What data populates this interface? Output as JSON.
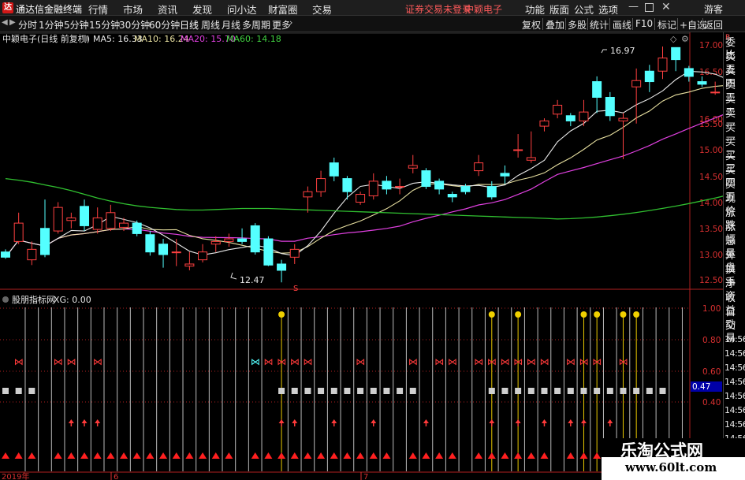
{
  "app": {
    "title": "通达信金融终端",
    "menu": [
      "行情",
      "市场",
      "资讯",
      "发现",
      "问小达",
      "财富圈",
      "交易"
    ],
    "notice": "证券交易未登录",
    "stock_name": "中颖电子",
    "right_menu": [
      "功能",
      "版面",
      "公式",
      "选项"
    ],
    "guest": "游客"
  },
  "toolbar": {
    "periods": [
      "分时",
      "1分钟",
      "5分钟",
      "15分钟",
      "30分钟",
      "60分钟",
      "日线",
      "周线",
      "月线",
      "多周期",
      "更多"
    ],
    "selected": "日线",
    "right_buttons": [
      "复权",
      "叠加",
      "多股",
      "统计",
      "画线",
      "F10",
      "标记",
      "+自选",
      "返回"
    ]
  },
  "kline": {
    "legend_title": "中颖电子(日线 前复权)",
    "ma": [
      {
        "label": "MA5: 16.33",
        "color": "#e8e8e8"
      },
      {
        "label": "MA10: 16.24",
        "color": "#e8e0a0"
      },
      {
        "label": "MA20: 15.70",
        "color": "#e040e0"
      },
      {
        "label": "MA60: 14.18",
        "color": "#40d040"
      }
    ],
    "price_axis": [
      "17.00",
      "16.50",
      "16.00",
      "15.50",
      "15.00",
      "14.50",
      "14.00",
      "13.50",
      "13.00",
      "12.50"
    ],
    "high_label": "16.97",
    "low_label": "12.47",
    "marker_s": "S",
    "colors": {
      "up": "#ff4040",
      "down": "#54ffff",
      "ma5": "#e8e8e8",
      "ma10": "#e8e0a0",
      "ma20": "#e040e0",
      "ma60": "#30c030"
    }
  },
  "indicator": {
    "name": "股朋指标网",
    "label": "XG: 0.00",
    "axis": [
      "1.00",
      "0.80",
      "0.60",
      "0.40"
    ],
    "current": "0.47"
  },
  "xaxis": {
    "year": "2019年",
    "m6": "6",
    "m7": "7"
  },
  "quote_panel": {
    "labels": [
      "委比",
      "卖五",
      "卖四",
      "卖三",
      "卖二",
      "卖一",
      "买一",
      "买二",
      "买三",
      "买四",
      "买五",
      "现价",
      "涨跌",
      "涨幅",
      "总量",
      "外盘",
      "换手",
      "净资",
      "收益"
    ],
    "bottom": [
      "自动",
      "交易",
      "14:56",
      "14:56",
      "14:56",
      "14:56",
      "14:56",
      "14:56",
      "14:56",
      "14:56"
    ]
  },
  "watermark": {
    "title": "乐淘公式网",
    "url": "www.60lt.com"
  },
  "chart_data": {
    "type": "candlestick",
    "open": [
      13.05,
      13.25,
      12.9,
      13.5,
      13.45,
      13.65,
      13.92,
      13.48,
      13.5,
      13.52,
      13.6,
      13.38,
      13.2,
      13.05,
      12.78,
      12.9,
      13.2,
      13.25,
      13.3,
      13.55,
      13.3,
      12.82,
      12.95,
      14.1,
      14.2,
      14.75,
      14.45,
      14.0,
      14.12,
      14.4,
      14.3,
      14.65,
      14.6,
      14.4,
      14.15,
      14.3,
      14.6,
      14.3,
      14.55,
      15.0,
      14.8,
      15.45,
      15.68,
      15.65,
      15.55,
      16.3,
      16.0,
      15.55,
      16.2,
      16.5,
      16.5,
      16.95,
      16.55,
      16.3,
      16.1,
      16.22,
      16.0
    ],
    "close": [
      12.95,
      13.6,
      13.1,
      13.0,
      13.9,
      13.7,
      13.55,
      13.7,
      13.8,
      13.6,
      13.4,
      13.05,
      13.0,
      13.05,
      12.82,
      13.05,
      13.25,
      13.3,
      13.25,
      13.05,
      12.8,
      12.7,
      13.1,
      14.2,
      14.45,
      14.5,
      14.2,
      14.15,
      14.4,
      14.25,
      14.3,
      14.7,
      14.3,
      14.25,
      14.1,
      14.2,
      14.75,
      14.1,
      14.5,
      15.0,
      14.85,
      15.55,
      15.85,
      15.55,
      15.72,
      16.0,
      15.65,
      15.6,
      16.32,
      16.3,
      16.75,
      16.72,
      16.4,
      16.25,
      16.1,
      16.22,
      16.3
    ],
    "high": [
      13.1,
      13.8,
      13.25,
      14.05,
      14.0,
      13.8,
      14.05,
      13.9,
      13.95,
      13.7,
      13.65,
      13.45,
      13.3,
      13.3,
      13.05,
      13.2,
      13.35,
      13.4,
      13.5,
      13.6,
      13.35,
      12.9,
      13.2,
      14.3,
      14.6,
      14.85,
      14.5,
      14.2,
      14.55,
      14.5,
      14.45,
      14.9,
      14.65,
      14.45,
      14.2,
      14.35,
      14.9,
      14.4,
      14.7,
      15.3,
      15.35,
      15.6,
      15.95,
      15.7,
      15.95,
      16.4,
      16.1,
      15.7,
      16.55,
      16.62,
      16.97,
      16.95,
      16.6,
      16.4,
      16.3,
      16.5,
      16.4
    ],
    "low": [
      12.92,
      13.2,
      12.8,
      12.95,
      13.4,
      13.5,
      13.45,
      13.4,
      13.45,
      13.45,
      13.35,
      12.98,
      12.75,
      12.78,
      12.7,
      12.85,
      13.05,
      13.15,
      13.2,
      13.0,
      12.78,
      12.47,
      12.82,
      13.8,
      14.1,
      14.4,
      14.05,
      13.95,
      14.05,
      14.15,
      14.15,
      14.55,
      14.25,
      14.15,
      14.0,
      14.15,
      14.5,
      14.05,
      14.35,
      14.85,
      14.75,
      15.35,
      15.6,
      15.45,
      15.45,
      15.7,
      15.55,
      14.82,
      15.5,
      16.1,
      16.35,
      16.5,
      16.3,
      16.2,
      16.05,
      16.0,
      15.92
    ]
  }
}
